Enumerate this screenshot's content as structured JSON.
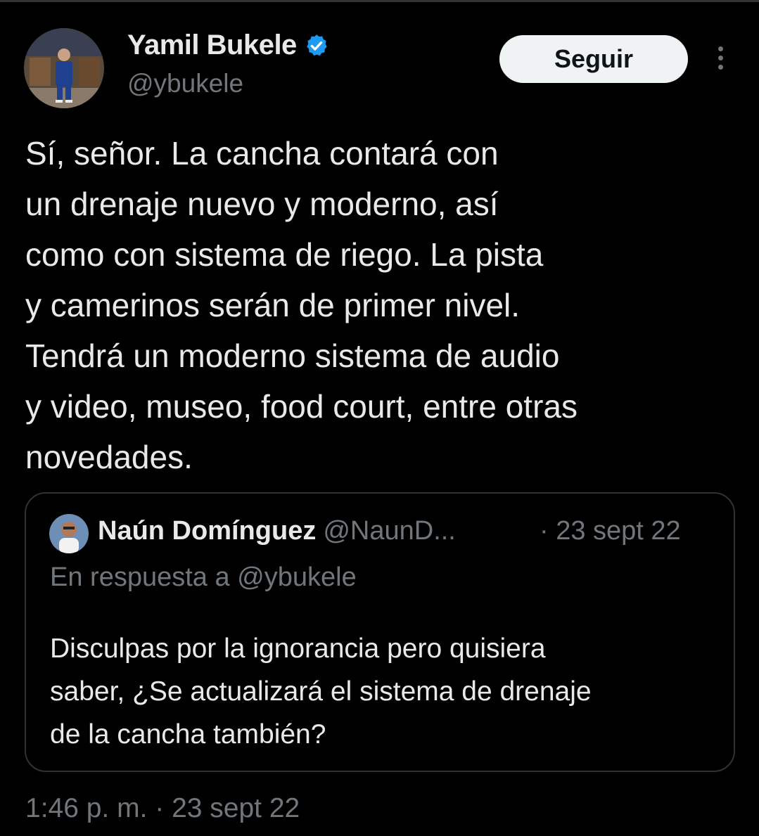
{
  "author": {
    "name": "Yamil Bukele",
    "handle": "@ybukele",
    "verified_color": "#1d9bf0"
  },
  "follow_label": "Seguir",
  "tweet": {
    "text": "Sí, señor. La cancha contará con\nun drenaje nuevo y moderno, así\ncomo con sistema de riego. La pista\ny camerinos serán de primer nivel.\nTendrá un moderno sistema de audio\ny video, museo, food court, entre otras\nnovedades.",
    "timestamp": "1:46 p. m. · 23 sept 22"
  },
  "quoted": {
    "name": "Naún Domínguez",
    "handle": "@NaunD...",
    "date": "· 23 sept 22",
    "reply_to": "En respuesta a @ybukele",
    "text": "Disculpas por la ignorancia pero quisiera\nsaber, ¿Se actualizará el sistema de drenaje\nde la cancha también?"
  },
  "colors": {
    "background": "#000000",
    "text": "#e7e9ea",
    "secondary": "#71767b",
    "border": "#2f3336",
    "button_bg": "#eff3f4"
  },
  "icons": [
    "verified-badge-icon",
    "more-options-icon"
  ]
}
